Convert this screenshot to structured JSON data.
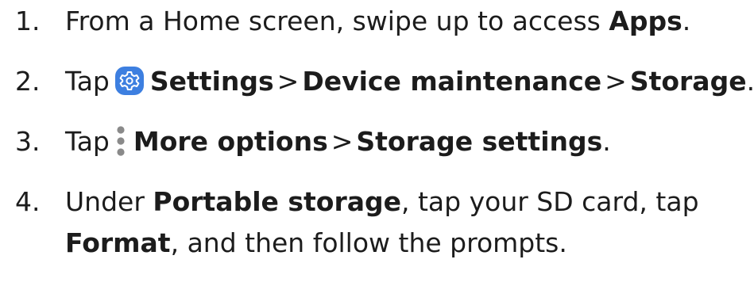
{
  "steps": [
    {
      "number": "1.",
      "text_1": "From a Home screen, swipe up to access ",
      "bold_1": "Apps",
      "text_2": "."
    },
    {
      "number": "2.",
      "lead": "Tap",
      "icon": "settings-gear-icon",
      "bold_1": "Settings",
      "sep_1": ">",
      "bold_2": "Device maintenance",
      "sep_2": ">",
      "bold_3": "Storage",
      "end": "."
    },
    {
      "number": "3.",
      "lead": "Tap",
      "icon": "more-options-icon",
      "bold_1": "More options",
      "sep_1": ">",
      "bold_2": "Storage settings",
      "end": "."
    },
    {
      "number": "4.",
      "text_1": "Under ",
      "bold_1": "Portable storage",
      "text_2": ", tap your SD card, tap",
      "bold_2": "Format",
      "text_3": ", and then follow the prompts."
    }
  ],
  "colors": {
    "text": "#1c1c1c",
    "settings_icon_bg": "#3d7fe0",
    "more_icon_dots": "#8a8a8a"
  }
}
